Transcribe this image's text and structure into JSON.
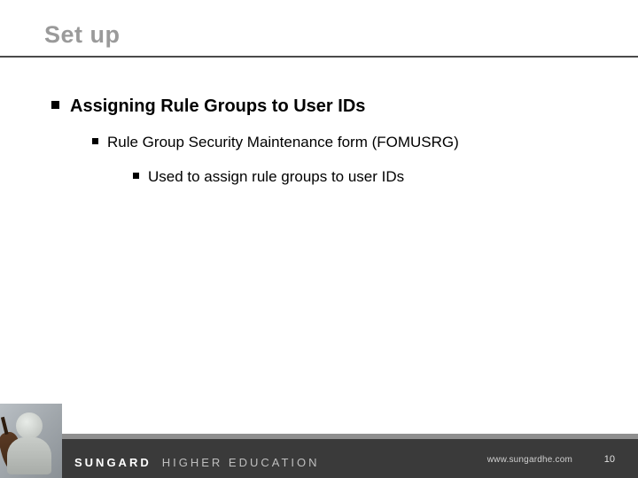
{
  "title": "Set up",
  "bullets": {
    "lvl1": "Assigning Rule Groups to User IDs",
    "lvl2": "Rule Group Security Maintenance form (FOMUSRG)",
    "lvl3": "Used to assign rule groups to user IDs"
  },
  "footer": {
    "brand_primary": "SUNGARD",
    "brand_secondary": "HIGHER EDUCATION",
    "url": "www.sungardhe.com",
    "page": "10"
  }
}
